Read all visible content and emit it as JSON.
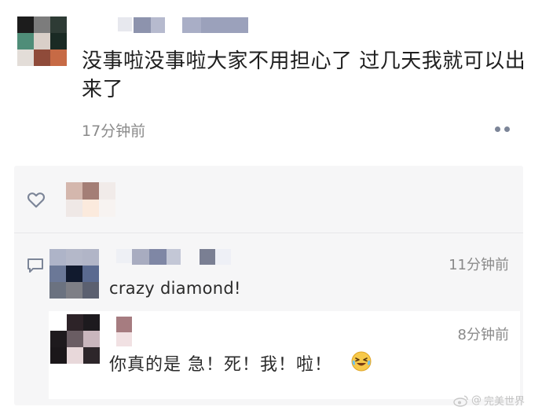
{
  "post": {
    "text": "没事啦没事啦大家不用担心了 过几天我就可以出来了",
    "time": "17分钟前",
    "more_icon": "more-dots-icon"
  },
  "likes": {
    "icon": "heart-icon"
  },
  "comments": [
    {
      "icon": "comment-icon",
      "time": "11分钟前",
      "text": "crazy diamond!"
    },
    {
      "time": "8分钟前",
      "text": "你真的是 急！死！我！啦！",
      "emoji": "laughing-tears-emoji"
    }
  ],
  "watermark": {
    "text": "完美世界"
  },
  "colors": {
    "panel_bg": "#f6f6f7",
    "time_gray": "#8a8a8a",
    "icon_gray": "#7c8598"
  }
}
